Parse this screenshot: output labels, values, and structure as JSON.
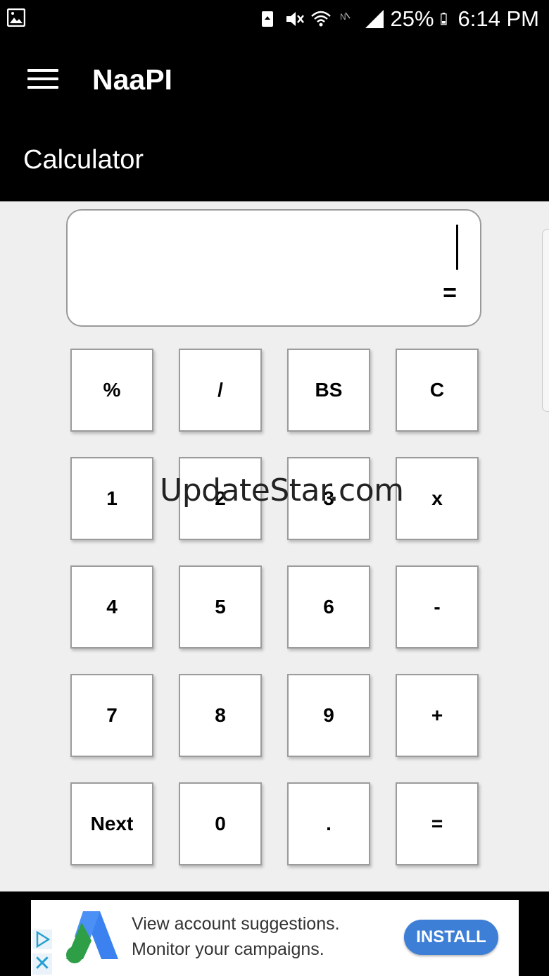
{
  "status_bar": {
    "battery": "25%",
    "time": "6:14 PM",
    "icons": [
      "gallery-icon",
      "recycle-icon",
      "mute-icon",
      "wifi-icon",
      "nfc-icon",
      "signal-icon",
      "battery-icon"
    ]
  },
  "app_bar": {
    "title": "NaaPI",
    "section": "Calculator"
  },
  "display": {
    "expression": "",
    "result_prefix": "="
  },
  "keypad": {
    "rows": [
      [
        "%",
        "/",
        "BS",
        "C"
      ],
      [
        "1",
        "2",
        "3",
        "x"
      ],
      [
        "4",
        "5",
        "6",
        "-"
      ],
      [
        "7",
        "8",
        "9",
        "+"
      ],
      [
        "Next",
        "0",
        ".",
        "="
      ]
    ]
  },
  "watermark": "UpdateStar.com",
  "ad": {
    "line1": "View account suggestions.",
    "line2": "Monitor your campaigns.",
    "button": "INSTALL",
    "close": "✕",
    "colors": {
      "button": "#3d7fd6",
      "logo_blue": "#3b82f0",
      "logo_green": "#2e9e47"
    }
  }
}
